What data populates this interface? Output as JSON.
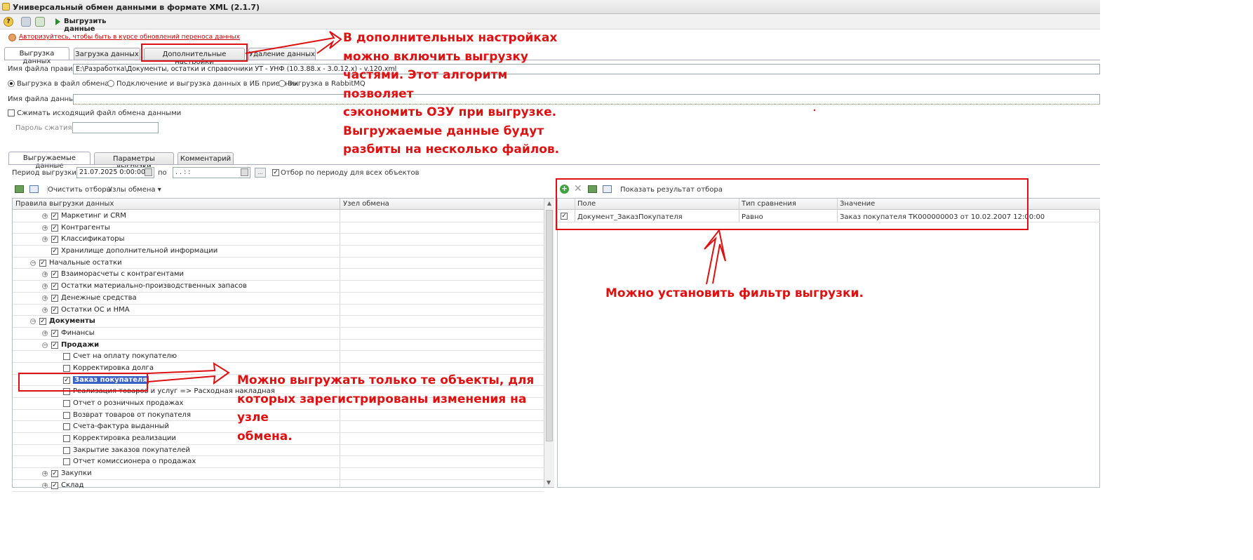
{
  "window": {
    "title": "Универсальный обмен данными в формате XML (2.1.7)"
  },
  "toolbar": {
    "run_label": "Выгрузить данные"
  },
  "auth_link": "Авторизуйтесь, чтобы быть в курсе обновлений переноса данных",
  "main_tabs": [
    "Выгрузка данных",
    "Загрузка данных",
    "Дополнительные настройки",
    "Удаление данных"
  ],
  "rules_file": {
    "label": "Имя файла правил:",
    "value": "E:\\Разработка\\Документы, остатки и справочники УТ - УНФ (10.3.88.x - 3.0.12.x) - v.120.xml"
  },
  "export_modes": [
    "Выгрузка в файл обмена",
    "Подключение и выгрузка данных в ИБ приемник",
    "Выгрузка в RabbitMQ"
  ],
  "data_file": {
    "label": "Имя файла данных:",
    "value": ""
  },
  "compress": {
    "label": "Сжимать исходящий файл обмена данными",
    "password_label": "Пароль сжатия:"
  },
  "sub_tabs": [
    "Выгружаемые данные",
    "Параметры выгрузки",
    "Комментарий"
  ],
  "period": {
    "label": "Период выгрузки:",
    "from": "21.07.2025  0:00:00",
    "to_label": "по",
    "to": " .  .     :  :",
    "filter_label": "Отбор по периоду для всех объектов"
  },
  "left_toolbar": {
    "clear": "Очистить отборы",
    "nodes": "Узлы обмена"
  },
  "tree": {
    "columns": [
      "Правила выгрузки данных",
      "Узел обмена"
    ],
    "rows": [
      {
        "label": "Маркетинг и CRM",
        "level": 1,
        "expand": "+",
        "checked": true
      },
      {
        "label": "Контрагенты",
        "level": 1,
        "expand": "+",
        "checked": true
      },
      {
        "label": "Классификаторы",
        "level": 1,
        "expand": "+",
        "checked": true
      },
      {
        "label": "Хранилище дополнительной информации",
        "level": 1,
        "expand": "",
        "checked": true
      },
      {
        "label": "Начальные остатки",
        "level": 0,
        "expand": "-",
        "checked": true
      },
      {
        "label": "Взаиморасчеты с контрагентами",
        "level": 1,
        "expand": "+",
        "checked": true
      },
      {
        "label": "Остатки материально-производственных запасов",
        "level": 1,
        "expand": "+",
        "checked": true
      },
      {
        "label": "Денежные средства",
        "level": 1,
        "expand": "+",
        "checked": true
      },
      {
        "label": "Остатки ОС и НМА",
        "level": 1,
        "expand": "+",
        "checked": true
      },
      {
        "label": "Документы",
        "level": 0,
        "expand": "-",
        "checked": true,
        "bold": true
      },
      {
        "label": "Финансы",
        "level": 1,
        "expand": "+",
        "checked": true
      },
      {
        "label": "Продажи",
        "level": 1,
        "expand": "-",
        "checked": true,
        "bold": true
      },
      {
        "label": "Счет на оплату покупателю",
        "level": 2,
        "expand": "",
        "checked": false
      },
      {
        "label": "Корректировка долга",
        "level": 2,
        "expand": "",
        "checked": false
      },
      {
        "label": "Заказ покупателя",
        "level": 2,
        "expand": "",
        "checked": true,
        "selected": true
      },
      {
        "label": "Реализация товаров и услуг  => Расходная накладная",
        "level": 2,
        "expand": "",
        "checked": false
      },
      {
        "label": "Отчет о розничных продажах",
        "level": 2,
        "expand": "",
        "checked": false
      },
      {
        "label": "Возврат товаров от покупателя",
        "level": 2,
        "expand": "",
        "checked": false
      },
      {
        "label": "Счета-фактура выданный",
        "level": 2,
        "expand": "",
        "checked": false
      },
      {
        "label": "Корректировка реализации",
        "level": 2,
        "expand": "",
        "checked": false
      },
      {
        "label": "Закрытие заказов покупателей",
        "level": 2,
        "expand": "",
        "checked": false
      },
      {
        "label": "Отчет комиссионера о продажах",
        "level": 2,
        "expand": "",
        "checked": false
      },
      {
        "label": "Закупки",
        "level": 1,
        "expand": "+",
        "checked": true
      },
      {
        "label": "Склад",
        "level": 1,
        "expand": "+",
        "checked": true
      }
    ]
  },
  "filter": {
    "show_result": "Показать результат отбора",
    "columns": [
      "Поле",
      "Тип сравнения",
      "Значение"
    ],
    "rows": [
      {
        "checked": true,
        "field": "Документ_ЗаказПокупателя",
        "comparison": "Равно",
        "value": "Заказ покупателя ТК000000003 от 10.02.2007 12:00:00"
      }
    ]
  },
  "annotations": {
    "top_right": [
      "В дополнительных настройках",
      "можно включить выгрузку",
      "частями. Этот алгоритм позволяет",
      "сэкономить ОЗУ при выгрузке.",
      "Выгружаемые данные будут",
      "разбиты на несколько файлов."
    ],
    "filter_note": "Можно установить фильтр выгрузки.",
    "bottom": [
      "Можно выгружать только те объекты, для",
      "которых зарегистрированы изменения на узле",
      "обмена."
    ]
  },
  "colors": {
    "annotation": "#dd1111",
    "selection": "#3a62c5"
  }
}
